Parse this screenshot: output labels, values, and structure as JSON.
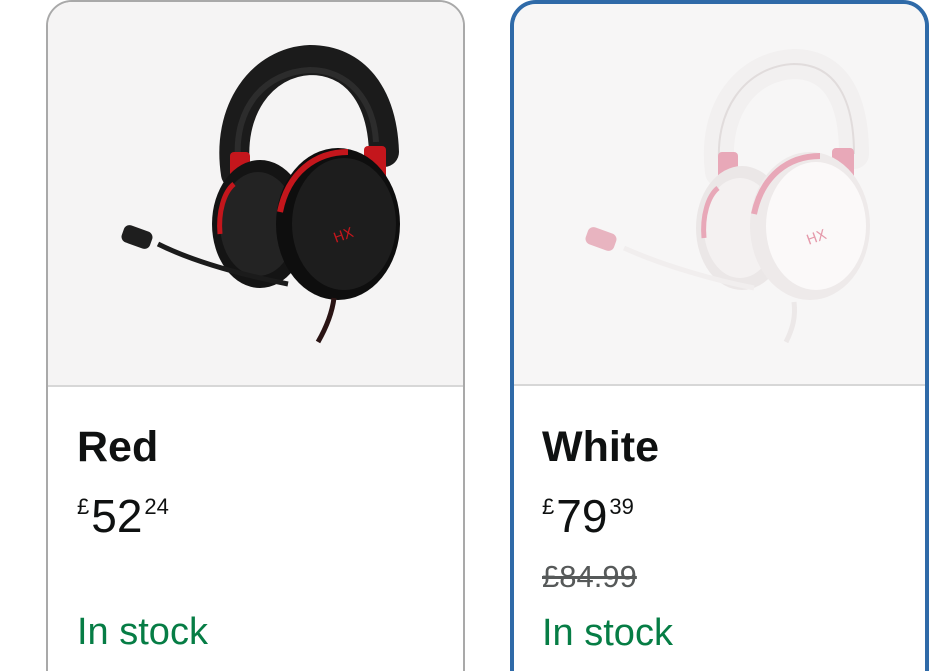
{
  "variants": [
    {
      "color_name": "Red",
      "price": {
        "symbol": "£",
        "whole": "52",
        "fraction": "24"
      },
      "was_price": "",
      "stock": "In stock",
      "selected": false
    },
    {
      "color_name": "White",
      "price": {
        "symbol": "£",
        "whole": "79",
        "fraction": "39"
      },
      "was_price": "£84.99",
      "stock": "In stock",
      "selected": true
    }
  ],
  "colors": {
    "selected_border": "#2f6aa8",
    "unselected_border": "#a9a9a9",
    "in_stock": "#067d45",
    "text_primary": "#0f1111",
    "text_secondary": "#565959"
  }
}
